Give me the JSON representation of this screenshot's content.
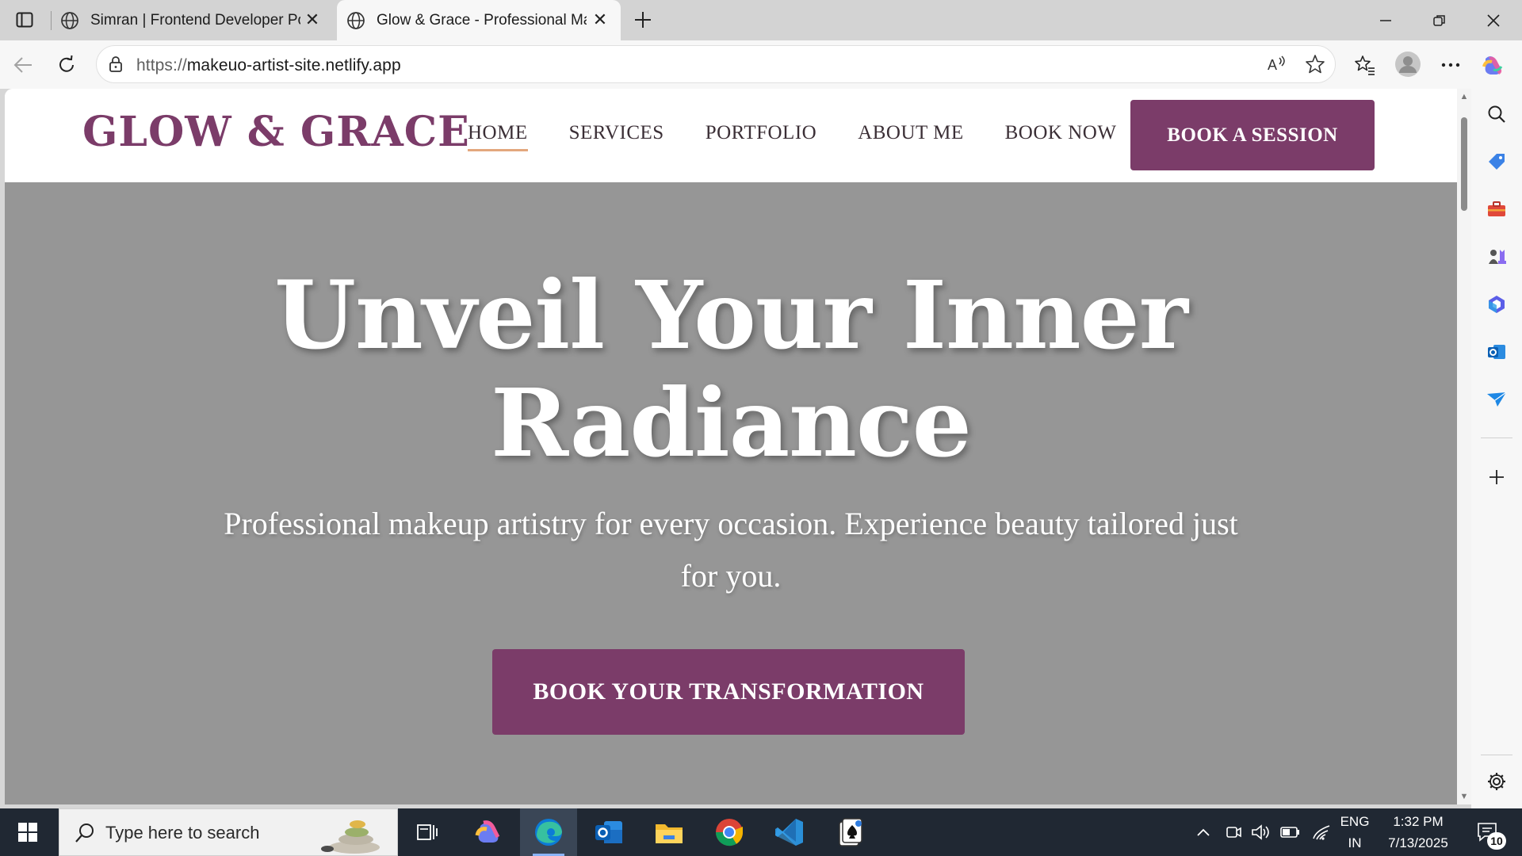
{
  "browser": {
    "tabs": [
      {
        "title": "Simran | Frontend Developer Portfolio",
        "active": false
      },
      {
        "title": "Glow & Grace - Professional Makeup Artist",
        "active": true
      }
    ],
    "address": {
      "protocol": "https://",
      "host": "makeuo-artist-site.netlify.app"
    }
  },
  "site": {
    "logo": "GLOW & GRACE",
    "nav": [
      {
        "label": "HOME",
        "active": true
      },
      {
        "label": "SERVICES",
        "active": false
      },
      {
        "label": "PORTFOLIO",
        "active": false
      },
      {
        "label": "ABOUT ME",
        "active": false
      },
      {
        "label": "BOOK NOW",
        "active": false
      }
    ],
    "nav_cta": "BOOK A SESSION",
    "hero": {
      "title_line1": "Unveil Your Inner",
      "title_line2": "Radiance",
      "subtitle": "Professional makeup artistry for every occasion. Experience beauty tailored just for you.",
      "cta": "BOOK YOUR TRANSFORMATION"
    },
    "colors": {
      "accent": "#7b3c69",
      "nav_underline": "#e3a77d",
      "hero_bg": "#969696"
    }
  },
  "taskbar": {
    "search_placeholder": "Type here to search",
    "language": {
      "line1": "ENG",
      "line2": "IN"
    },
    "time": "1:32 PM",
    "date": "7/13/2025",
    "notification_count": "10"
  }
}
